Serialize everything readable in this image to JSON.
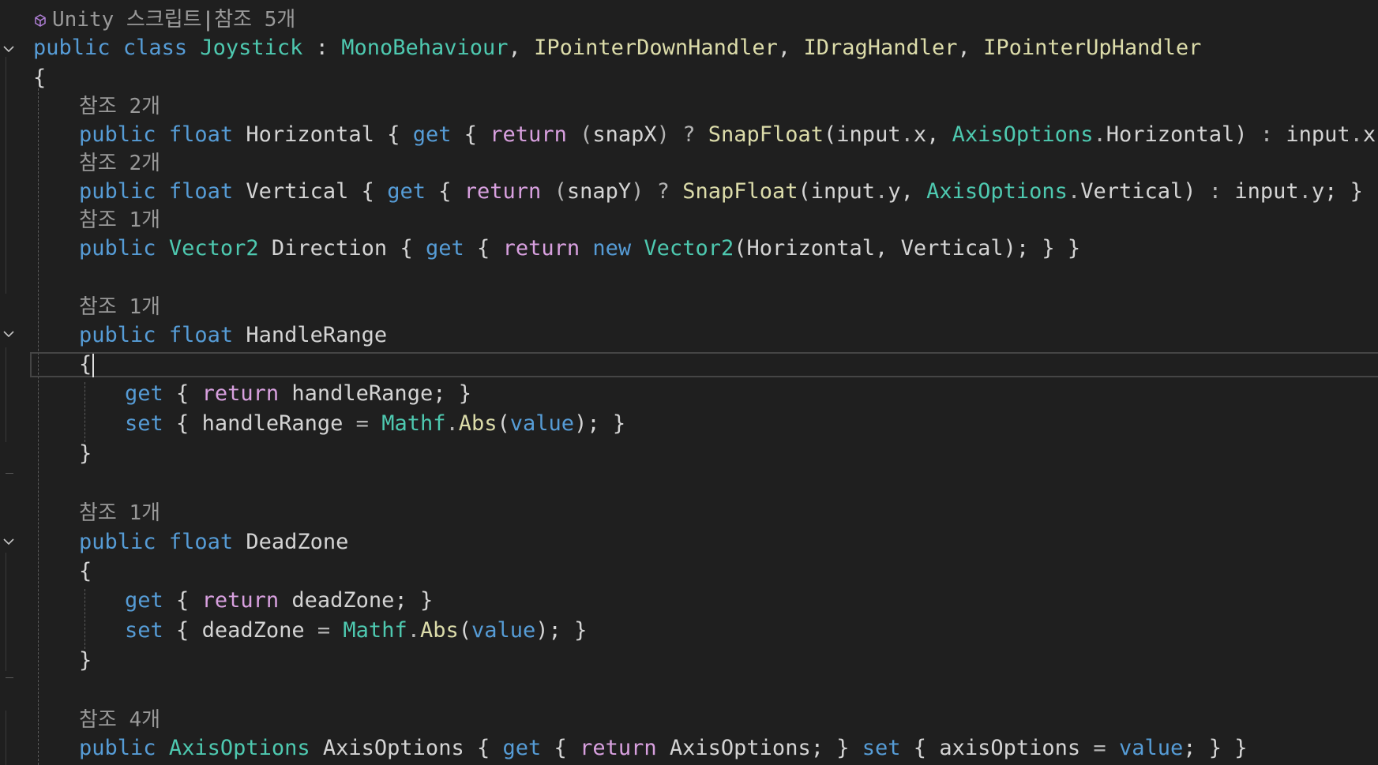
{
  "editor": {
    "codelens": {
      "class_prefix": "Unity 스크립트",
      "class_refs": "참조 5개",
      "horizontal_refs": "참조 2개",
      "vertical_refs": "참조 2개",
      "direction_refs": "참조 1개",
      "handlerange_refs": "참조 1개",
      "deadzone_refs": "참조 1개",
      "axisoptions_refs": "참조 4개"
    },
    "code": {
      "public": "public",
      "class": "class",
      "float": "float",
      "get": "get",
      "set": "set",
      "return": "return",
      "new": "new",
      "value": "value",
      "class_name": "Joystick",
      "mono": "MonoBehaviour",
      "ipd": "IPointerDownHandler",
      "idrag": "IDragHandler",
      "ipu": "IPointerUpHandler",
      "horizontal": "Horizontal",
      "vertical": "Vertical",
      "direction": "Direction",
      "vector2": "Vector2",
      "snapx": "snapX",
      "snapy": "snapY",
      "snapfloat": "SnapFloat",
      "input": "input",
      "x": "x",
      "y": "y",
      "axisoptions_type": "AxisOptions",
      "handlerange_prop": "HandleRange",
      "handlerange_field": "handleRange",
      "mathf": "Mathf",
      "abs": "Abs",
      "deadzone_prop": "DeadZone",
      "deadzone_field": "deadZone",
      "axisoptions_prop": "AxisOptions",
      "axisoptions_field": "axisOptions"
    }
  },
  "colors": {
    "background": "#1f1f1f",
    "keyword": "#569cd6",
    "control": "#d8a0df",
    "type": "#4ec9b0",
    "method": "#dcdcaa",
    "text": "#d4d4d4",
    "codelens": "#999999"
  },
  "icons": {
    "fold": "chevron-down-icon",
    "unity": "unity-cube-icon"
  }
}
